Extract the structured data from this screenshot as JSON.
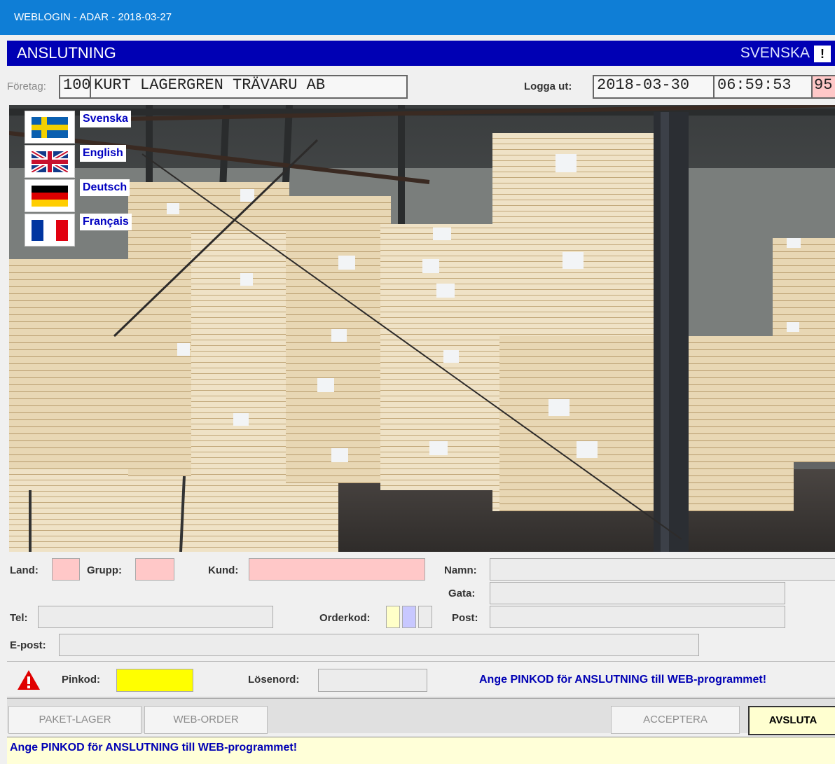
{
  "window": {
    "title": "WEBLOGIN - ADAR - 2018-03-27"
  },
  "header": {
    "title": "ANSLUTNING",
    "language": "SVENSKA",
    "alert_symbol": "!"
  },
  "company": {
    "label": "Företag:",
    "number": "100",
    "name": "KURT LAGERGREN TRÄVARU AB"
  },
  "session": {
    "logout_label": "Logga ut:",
    "date": "2018-03-30",
    "time": "06:59:53",
    "counter": "95"
  },
  "languages": [
    {
      "label": "Svenska",
      "flag": "flag-sweden-icon"
    },
    {
      "label": "English",
      "flag": "flag-uk-icon"
    },
    {
      "label": "Deutsch",
      "flag": "flag-germany-icon"
    },
    {
      "label": "Français",
      "flag": "flag-france-icon"
    }
  ],
  "form": {
    "land_label": "Land:",
    "grupp_label": "Grupp:",
    "kund_label": "Kund:",
    "namn_label": "Namn:",
    "gata_label": "Gata:",
    "tel_label": "Tel:",
    "orderkod_label": "Orderkod:",
    "post_label": "Post:",
    "epost_label": "E-post:"
  },
  "login": {
    "pin_label": "Pinkod:",
    "password_label": "Lösenord:",
    "message": "Ange PINKOD för ANSLUTNING till WEB-programmet!"
  },
  "buttons": {
    "paket_lager": "PAKET-LAGER",
    "web_order": "WEB-ORDER",
    "acceptera": "ACCEPTERA",
    "avsluta": "AVSLUTA"
  },
  "status": {
    "message": "Ange PINKOD för ANSLUTNING till WEB-programmet!"
  },
  "colors": {
    "header_blue": "#0000b4",
    "titlebar_blue": "#0f7ed6",
    "pin_yellow": "#ffff00",
    "field_pink": "#ffc8c8"
  }
}
